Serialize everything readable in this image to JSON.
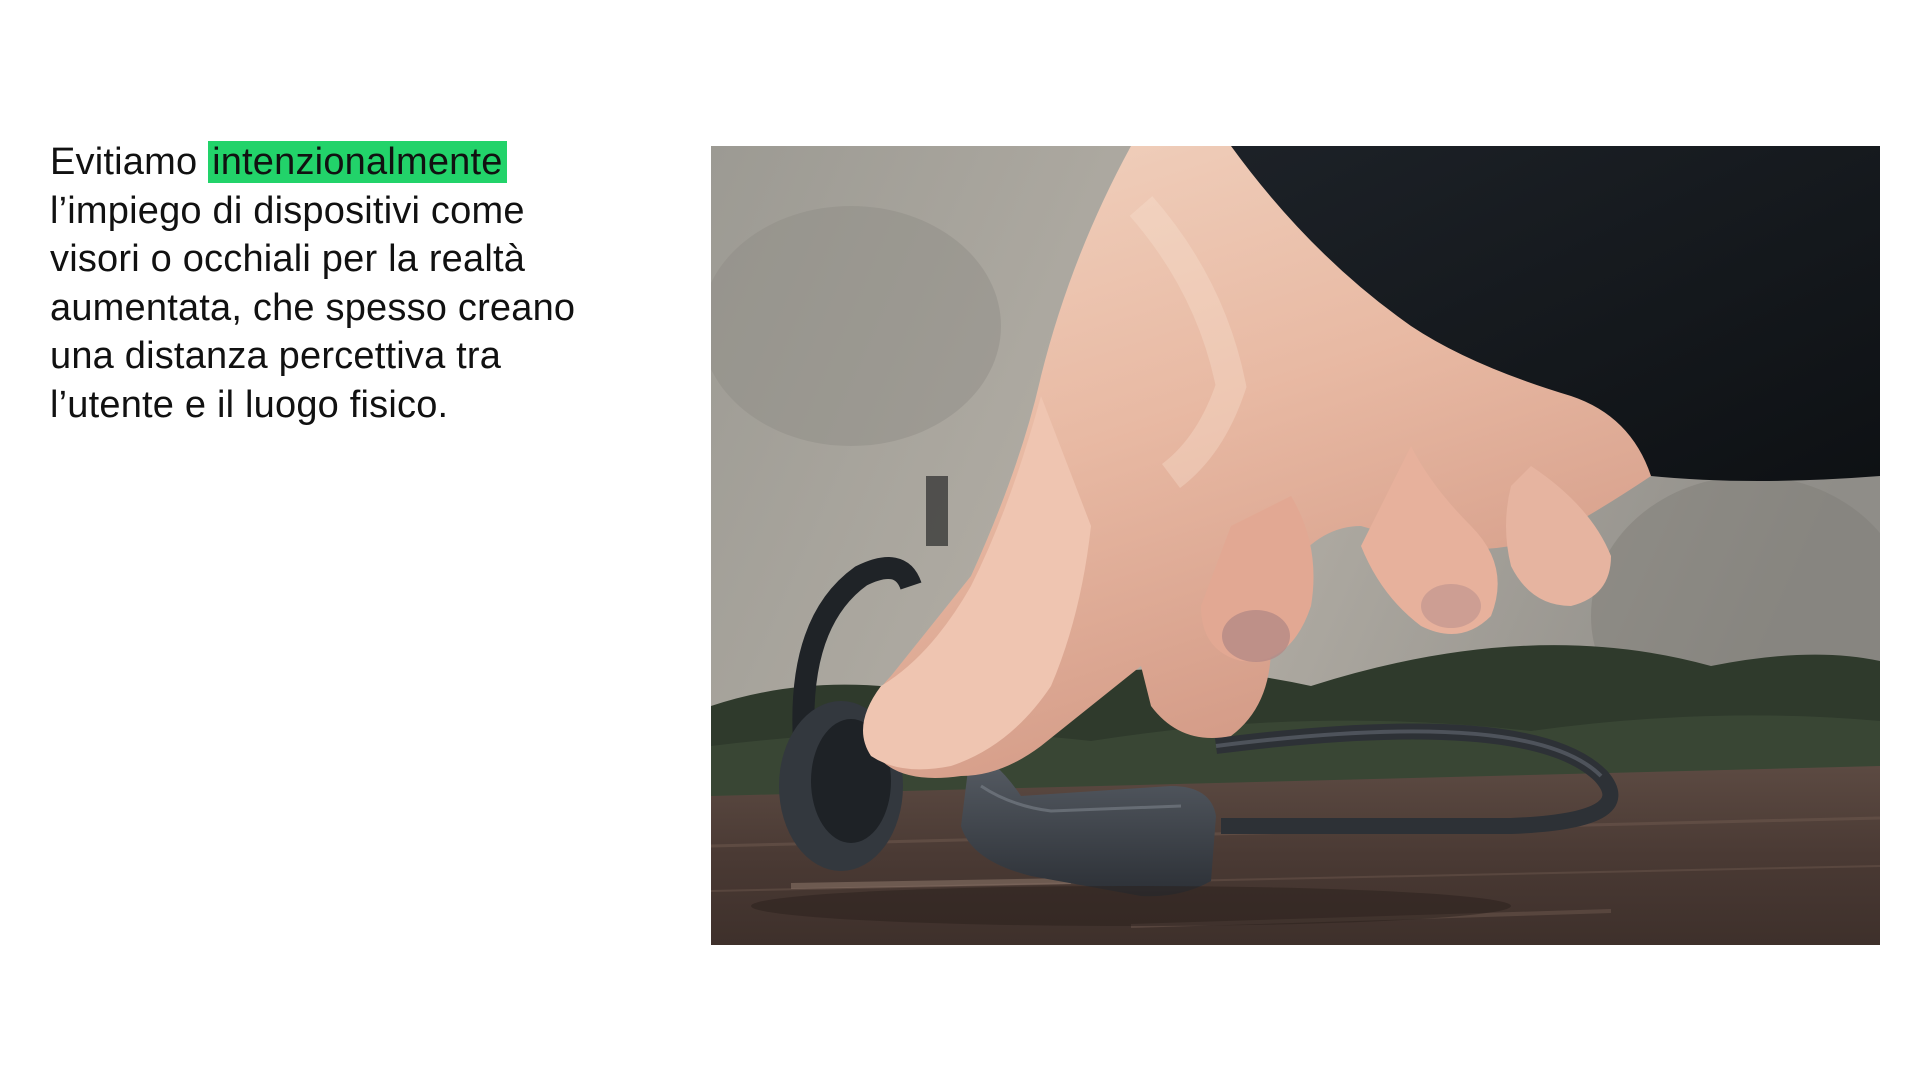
{
  "body_text": {
    "lead": "Evitiamo ",
    "highlight": "intenzionalmente",
    "line2": "l’impiego di dispositivi come",
    "line3": "visori o occhiali per la realtà",
    "line4": "aumentata, che spesso creano",
    "line5": "una distanza percettiva tra",
    "line6": "l’utente e il luogo fisico."
  },
  "colors": {
    "highlight": "#22d36a",
    "text": "#111111",
    "background": "#ffffff"
  },
  "photo": {
    "subject": "hand picking up bone-conduction headphones from a wooden table"
  }
}
